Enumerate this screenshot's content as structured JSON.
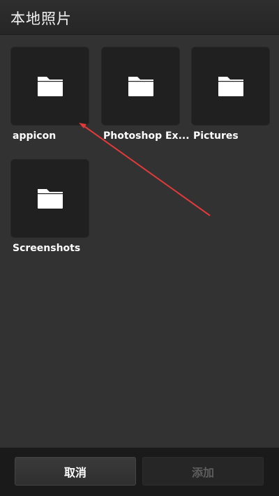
{
  "header": {
    "title": "本地照片"
  },
  "folders": [
    {
      "label": "appicon",
      "icon": "folder-icon"
    },
    {
      "label": "Photoshop Ex...",
      "icon": "folder-icon"
    },
    {
      "label": "Pictures",
      "icon": "folder-icon"
    },
    {
      "label": "Screenshots",
      "icon": "folder-icon"
    }
  ],
  "footer": {
    "cancel_label": "取消",
    "add_label": "添加"
  },
  "colors": {
    "background": "#323232",
    "tile": "#202020",
    "arrow": "#e03a3a"
  }
}
